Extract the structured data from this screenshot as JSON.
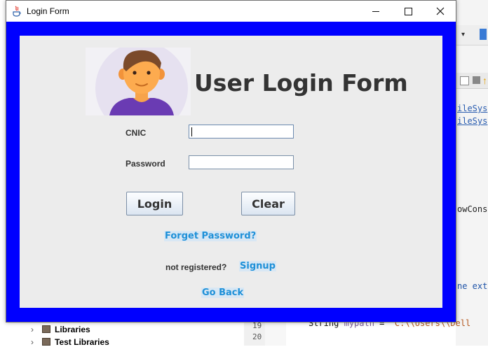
{
  "window": {
    "title": "Login Form"
  },
  "form": {
    "heading": "User Login Form",
    "cnic_label": "CNIC",
    "cnic_value": "",
    "password_label": "Password",
    "password_value": "",
    "login_button": "Login",
    "clear_button": "Clear",
    "forget_password_link": "Forget Password?",
    "not_registered_text": "not registered?",
    "signup_link": "Signup",
    "go_back_link": "Go Back"
  },
  "background_ide": {
    "code_fragments": [
      "ileSys",
      "ileSys",
      "owCons",
      "ne ext"
    ],
    "project_tree": [
      "Libraries",
      "Test Libraries"
    ],
    "line_numbers": [
      "19",
      "20"
    ],
    "code_line_keyword": "String",
    "code_line_variable": "mypath",
    "code_line_rest": " = ",
    "code_line_string": "\"C:\\\\Users\\\\Dell"
  },
  "colors": {
    "frame_blue": "#0000ff",
    "panel_gray": "#ececec",
    "link_blue": "#1e90d8"
  },
  "icons": [
    "java-app-icon",
    "minimize-icon",
    "maximize-icon",
    "close-icon",
    "user-avatar"
  ]
}
